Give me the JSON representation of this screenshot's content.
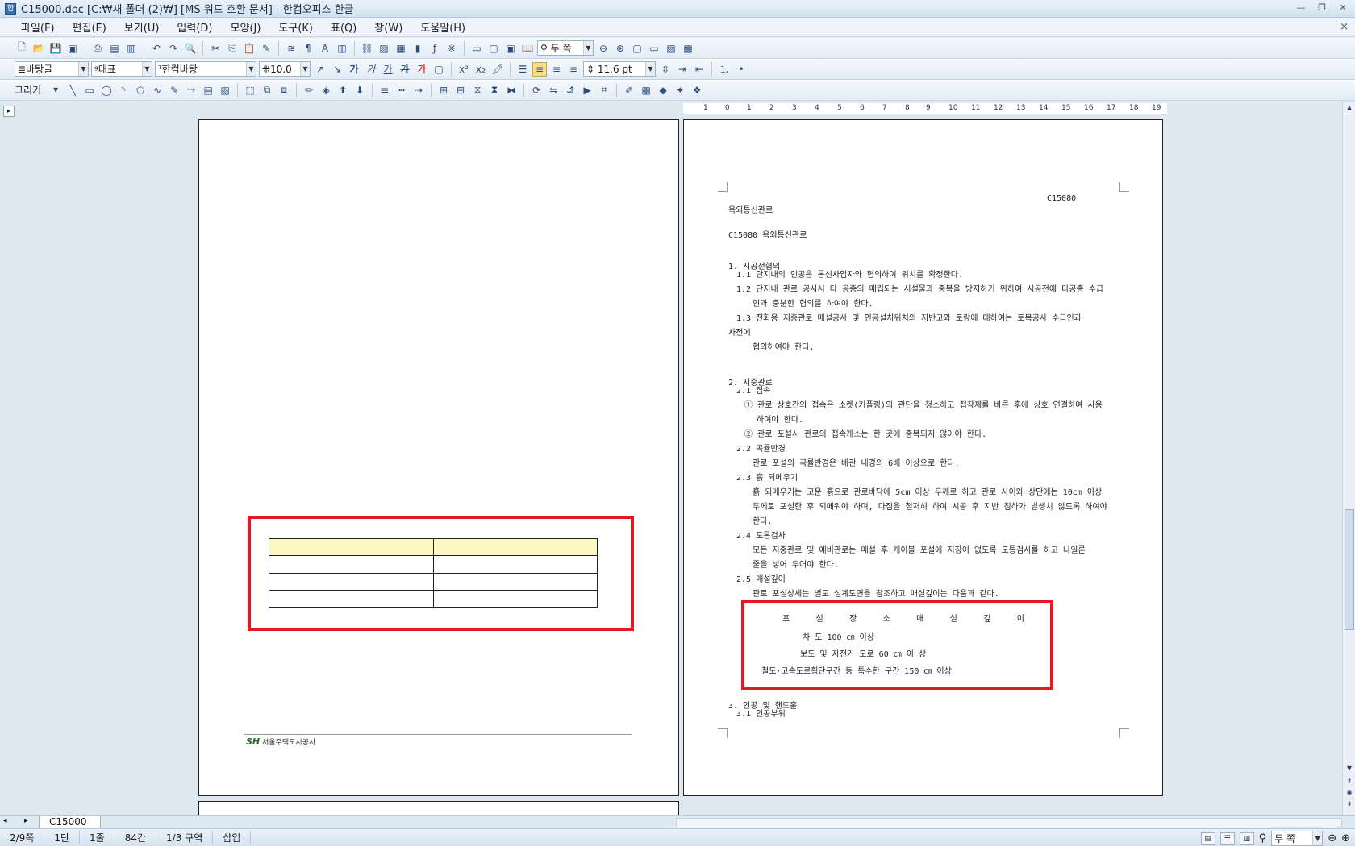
{
  "window": {
    "title": "C15000.doc [C:₩새 폴더 (2)₩] [MS 워드 호환 문서] - 한컴오피스 한글",
    "min": "—",
    "max": "❐",
    "close": "✕",
    "doc_close": "×"
  },
  "menu": [
    "파일(F)",
    "편집(E)",
    "보기(U)",
    "입력(D)",
    "모양(J)",
    "도구(K)",
    "표(Q)",
    "창(W)",
    "도움말(H)"
  ],
  "toolbar1": {
    "zoom": "두 쪽"
  },
  "toolbar2": {
    "style": "바탕글",
    "lang": "대표",
    "font": "한컴바탕",
    "size": "10.0",
    "bold": "가",
    "italic": "가",
    "underline": "가",
    "strike": "가",
    "color": "가",
    "spacing": "11.6 pt"
  },
  "toolbar3": {
    "draw_label": "그리기"
  },
  "ruler": {
    "ticks": [
      "1",
      "0",
      "1",
      "2",
      "3",
      "4",
      "5",
      "6",
      "7",
      "8",
      "9",
      "10",
      "11",
      "12",
      "13",
      "14",
      "15",
      "16",
      "17",
      "18",
      "19"
    ]
  },
  "left_page": {
    "footer_logo": "SH",
    "footer_text": "서울주택도시공사"
  },
  "right_page": {
    "header_code": "C15080",
    "lines": [
      "옥외통신관로",
      "C15080 옥외통신관로",
      "1. 시공전협의",
      "1.1 단지내의 인공은 통신사업자와 협의하여 위치를 확정한다.",
      "1.2 단지내 관로 공사시 타 공종의 매립되는 시설물과 중복을 방지하기 위하여 시공전에 타공종 수급",
      "인과 충분한 협의를 하여야 한다.",
      "1.3 전화용 지중관로 매설공사 및 인공설치위치의 지반고와 토량에 대하여는 토목공사 수급인과",
      "사전에",
      "협의하여야 한다.",
      "2. 지중관로",
      "2.1 접속",
      "① 관로 상호간의 접속은 소켓(커플링)의 관단을 청소하고 접착제를 바른 후에 상호 연결하여 사용",
      "하여야 한다.",
      "② 관로 포설시 관로의 접속개소는 한 곳에 중복되지 않아야 한다.",
      "2.2 곡률반경",
      "관로 포설의 곡률반경은 배관 내경의 6배 이상으로 한다.",
      "2.3 흙 되메우기",
      "흙 되메우기는 고운 흙으로 관로바닥에 5cm 이상 두께로 하고 관로 사이와 상단에는 10cm 이상",
      "두께로 포설한 후 되메워야 하며, 다짐을 철저히 하여 시공 후 지반 침하가 발생치 않도록 하여야",
      "한다.",
      "2.4 도통검사",
      "모든 지중관로 및 예비관로는 매설 후 케이블 포설에 지장이 없도록 도통검사를 하고 나일론",
      "줄을 넣어 두어야 한다.",
      "2.5 매설깊이",
      "관로 포설상세는 별도 설계도면을 참조하고 매설깊이는 다음과 같다.",
      "3. 인공 및 핸드홀",
      "3.1 인공부위"
    ],
    "depth_table": {
      "header": [
        "포",
        "설",
        "장",
        "소",
        "매",
        "설",
        "깊",
        "이"
      ],
      "rows": [
        "차   도       100 ㎝ 이상",
        "보도 및 자전거 도로    60 ㎝ 이 상",
        "철도·고속도로횡단구간 등 특수한 구간   150 ㎝ 이상"
      ]
    }
  },
  "tabs": {
    "doc_tab": "C15000"
  },
  "status": {
    "page": "2/9쪽",
    "column": "1단",
    "line": "1줄",
    "pos": "84칸",
    "section": "1/3 구역",
    "mode": "삽입",
    "zoom": "두 쪽"
  },
  "colors": {
    "highlight": "#e01b22",
    "table_header": "#fdf7c2"
  }
}
